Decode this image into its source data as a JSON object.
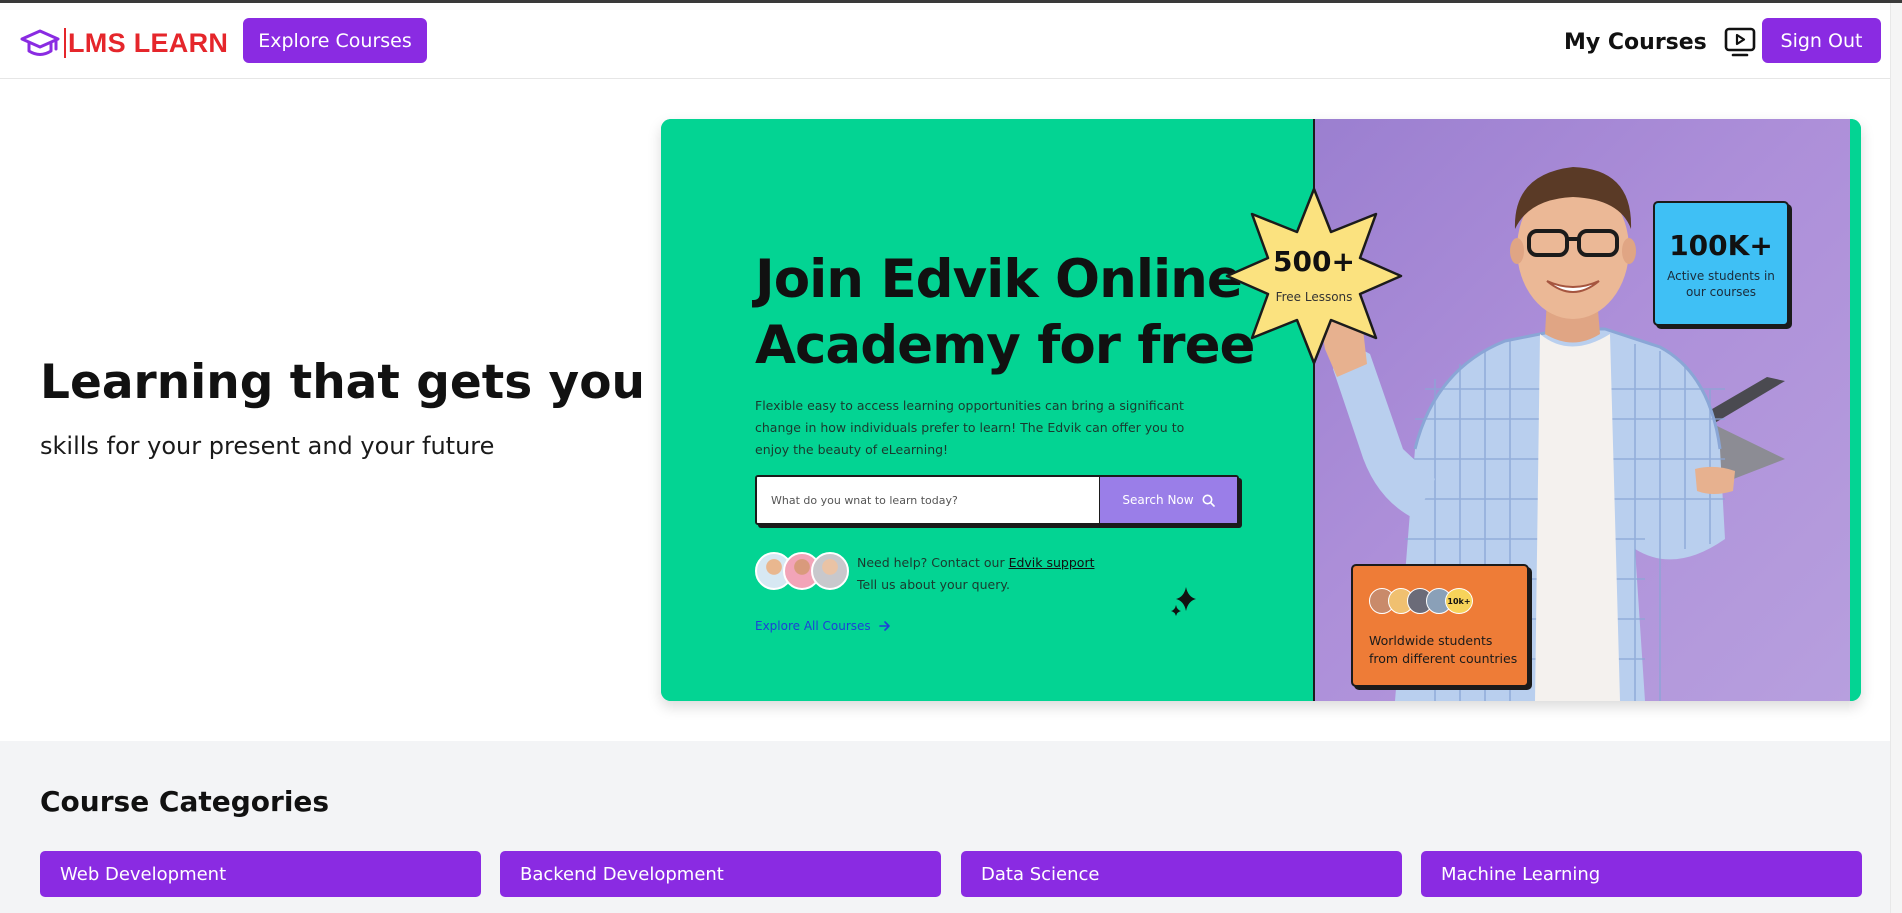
{
  "header": {
    "brand": "LMS LEARN",
    "explore_label": "Explore Courses",
    "my_courses_label": "My Courses",
    "sign_out_label": "Sign Out"
  },
  "hero": {
    "title": "Learning that gets you",
    "subtitle": "skills for your present and your future"
  },
  "banner": {
    "title": "Join Edvik Online Academy for free",
    "description": "Flexible easy to access learning opportunities can bring a significant change in how individuals prefer to learn! The Edvik can offer you to enjoy the beauty of eLearning!",
    "search_placeholder": "What do you wnat to learn today?",
    "search_button": "Search Now",
    "help_text": "Need help? Contact our",
    "help_link": "Edvik support",
    "help_sub": "Tell us about your query.",
    "explore_all": "Explore All Courses",
    "lessons_count": "500+",
    "lessons_label": "Free Lessons",
    "students_count": "100K+",
    "students_label": "Active students in our courses",
    "world_count": "10k+",
    "world_label": "Worldwide students from different countries"
  },
  "categories": {
    "title": "Course Categories",
    "items": [
      {
        "label": "Web Development"
      },
      {
        "label": "Backend Development"
      },
      {
        "label": "Data Science"
      },
      {
        "label": "Machine Learning"
      }
    ]
  },
  "colors": {
    "accent_purple": "#8a2be2",
    "brand_red": "#e5262b",
    "banner_green": "#03d493",
    "stat_blue": "#3fc0f5",
    "world_orange": "#ee7c37",
    "star_yellow": "#fbe27f"
  },
  "icons": {
    "logo": "graduation-cap-icon",
    "my_courses": "tv-play-icon",
    "search": "search-icon",
    "arrow": "arrow-right-icon",
    "sparkle": "sparkle-icon"
  }
}
